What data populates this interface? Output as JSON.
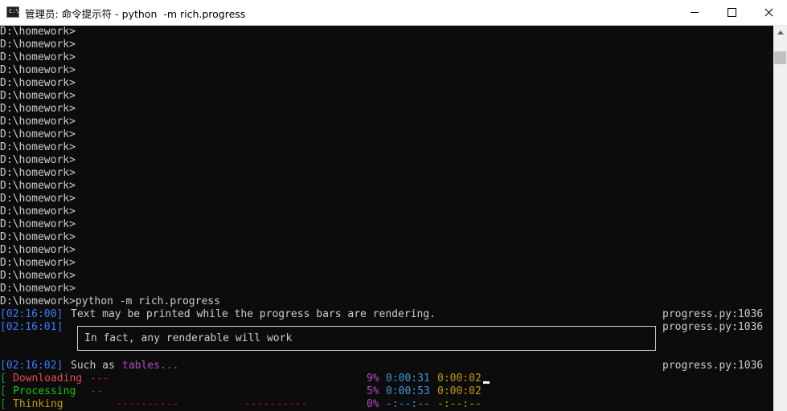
{
  "window": {
    "title": "管理员: 命令提示符 - python  -m rich.progress",
    "icon": "cmd-icon"
  },
  "console": {
    "prompt_lines": [
      "D:\\homework>",
      "D:\\homework>",
      "D:\\homework>",
      "D:\\homework>",
      "D:\\homework>",
      "D:\\homework>",
      "D:\\homework>",
      "D:\\homework>",
      "D:\\homework>",
      "D:\\homework>",
      "D:\\homework>",
      "D:\\homework>",
      "D:\\homework>",
      "D:\\homework>",
      "D:\\homework>",
      "D:\\homework>",
      "D:\\homework>",
      "D:\\homework>",
      "D:\\homework>",
      "D:\\homework>",
      "D:\\homework>",
      "D:\\homework>"
    ],
    "command": "D:\\homework>python -m rich.progress",
    "log1": {
      "time": "[02:16:00]",
      "text": "Text may be printed while the progress bars are rendering.",
      "src": "progress.py:1036"
    },
    "log2": {
      "time": "[02:16:01]",
      "src": "progress.py:1036"
    },
    "panel_text": "In fact, any renderable will work",
    "log3": {
      "time": "[02:16:02]",
      "text": "Such as ",
      "highlight": "tables...",
      "src": "progress.py:1036"
    },
    "tasks": [
      {
        "bracket": "[",
        "name": "Downloading",
        "bar": "---",
        "bar2": "",
        "percent": "9%",
        "elapsed": "0:00:31",
        "remaining": "0:00:02"
      },
      {
        "bracket": "[",
        "name": "Processing",
        "bar": "--",
        "bar2": "",
        "percent": "5%",
        "elapsed": "0:00:53",
        "remaining": "0:00:02"
      },
      {
        "bracket": "[",
        "name": "Thinking",
        "bar": "----------",
        "bar2": "----------",
        "percent": "0%",
        "elapsed": "-:--:--",
        "remaining": "-:--:--"
      }
    ]
  }
}
